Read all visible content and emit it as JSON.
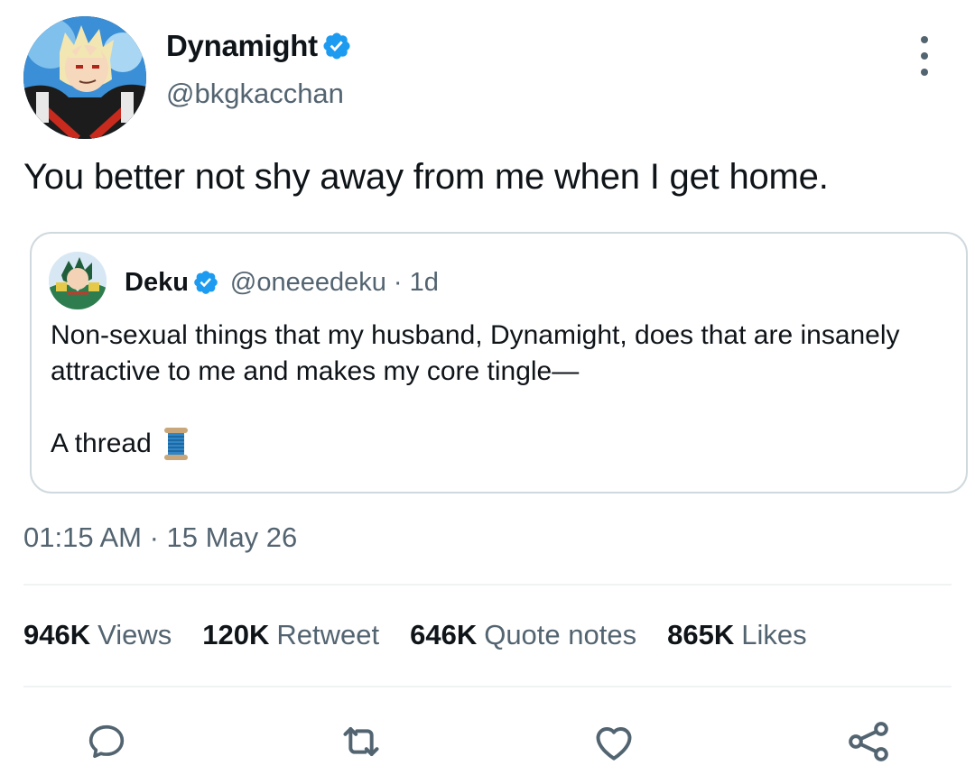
{
  "author": {
    "display_name": "Dynamight",
    "handle": "@bkgkacchan",
    "verified": true
  },
  "tweet": {
    "text": "You better not shy away from me when I get home.",
    "timestamp": "01:15 AM · 15 May 26"
  },
  "quoted_tweet": {
    "display_name": "Deku",
    "handle": "@oneeedeku",
    "separator": "·",
    "time": "1d",
    "verified": true,
    "text": "Non-sexual things that my husband, Dynamight, does that are insanely attractive to me and makes my core tingle—",
    "thread_label": "A thread",
    "thread_emoji": "spool-of-thread"
  },
  "stats": [
    {
      "value": "946K",
      "label": "Views"
    },
    {
      "value": "120K",
      "label": "Retweet"
    },
    {
      "value": "646K",
      "label": "Quote notes"
    },
    {
      "value": "865K",
      "label": "Likes"
    }
  ],
  "actions": [
    {
      "icon": "reply-icon"
    },
    {
      "icon": "retweet-icon"
    },
    {
      "icon": "like-icon"
    },
    {
      "icon": "share-icon"
    }
  ],
  "colors": {
    "verified_blue": "#1d9bf0",
    "secondary_text": "#536471",
    "primary_text": "#0f1419",
    "border": "#cfd9de"
  }
}
